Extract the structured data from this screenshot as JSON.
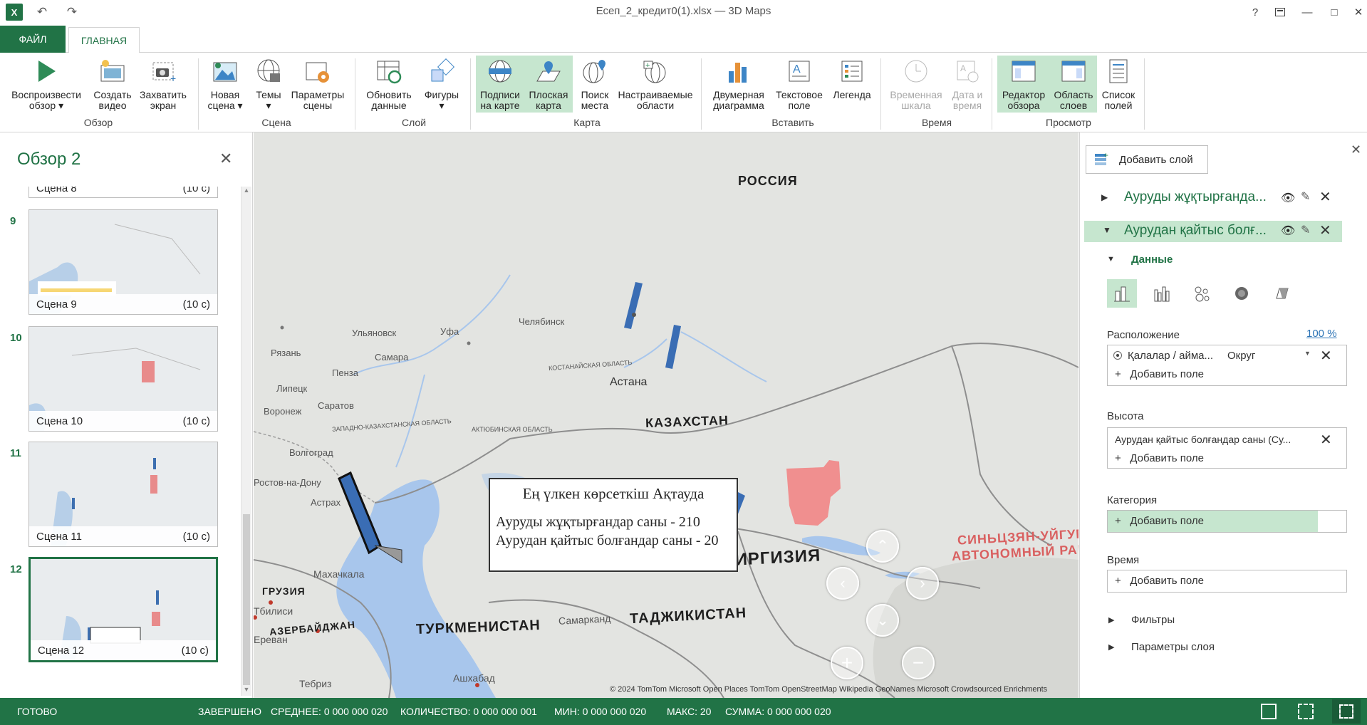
{
  "window": {
    "title": "Есеп_2_кредит0(1).xlsx — 3D Maps",
    "help": "?",
    "restore_icon": "restore-icon",
    "minimize": "—",
    "maximize": "□",
    "close": "✕"
  },
  "tabs": {
    "file": "ФАЙЛ",
    "home": "ГЛАВНАЯ"
  },
  "ribbon": {
    "play_tour": [
      "Воспроизвести",
      "обзор ▾"
    ],
    "create_video": [
      "Создать",
      "видео"
    ],
    "capture_screen": [
      "Захватить",
      "экран"
    ],
    "new_scene": [
      "Новая",
      "сцена ▾"
    ],
    "themes": [
      "Темы",
      "▾"
    ],
    "scene_options": [
      "Параметры",
      "сцены"
    ],
    "refresh_data": [
      "Обновить",
      "данные"
    ],
    "shapes": [
      "Фигуры",
      "▾"
    ],
    "map_labels": [
      "Подписи",
      "на карте"
    ],
    "flat_map": [
      "Плоская",
      "карта"
    ],
    "find_location": [
      "Поиск",
      "места"
    ],
    "custom_regions": [
      "Настраиваемые",
      "области"
    ],
    "chart_2d": [
      "Двумерная",
      "диаграмма"
    ],
    "text_box": [
      "Текстовое",
      "поле"
    ],
    "legend": [
      "Легенда",
      ""
    ],
    "timeline": [
      "Временная",
      "шкала"
    ],
    "date_time": [
      "Дата и",
      "время"
    ],
    "tour_editor": [
      "Редактор",
      "обзора"
    ],
    "layer_pane": [
      "Область",
      "слоев"
    ],
    "field_list": [
      "Список",
      "полей"
    ],
    "groups": {
      "tour": "Обзор",
      "scene": "Сцена",
      "layer": "Слой",
      "map": "Карта",
      "insert": "Вставить",
      "time": "Время",
      "view": "Просмотр"
    }
  },
  "tour_panel": {
    "title": "Обзор 2",
    "scenes": [
      {
        "num": "",
        "label": "Сцена 8",
        "duration": "(10 с)"
      },
      {
        "num": "9",
        "label": "Сцена 9",
        "duration": "(10 с)"
      },
      {
        "num": "10",
        "label": "Сцена 10",
        "duration": "(10 с)"
      },
      {
        "num": "11",
        "label": "Сцена 11",
        "duration": "(10 с)"
      },
      {
        "num": "12",
        "label": "Сцена 12",
        "duration": "(10 с)"
      }
    ]
  },
  "map": {
    "labels": {
      "russia": "РОССИЯ",
      "kazakhstan": "КАЗАХСТАН",
      "kyrgyzstan": "КИРГИЗИЯ",
      "tajikistan": "ТАДЖИКИСТАН",
      "turkmenistan": "ТУРКМЕНИСТАН",
      "georgia": "ГРУЗИЯ",
      "azerbaijan": "АЗЕРБАЙДЖАН",
      "xinjiang": [
        "СИНЬЦЗЯН-УЙГУР",
        "АВТОНОМНЫЙ РАЙ"
      ],
      "astana": "Астана",
      "ufa": "Уфа",
      "chelyabinsk": "Челябинск",
      "ulyanovsk": "Ульяновск",
      "samara": "Самара",
      "penza": "Пенза",
      "saratov": "Саратов",
      "ryazan": "Рязань",
      "lipetsk": "Липецк",
      "voronezh": "Воронеж",
      "volgograd": "Волгоград",
      "rostov": "Ростов-на-Дону",
      "astrakhan": "Астрах",
      "makhachkala": "Махачкала",
      "tbilisi": "Тбилиси",
      "yerevan": "Ереван",
      "tebriz": "Тебриз",
      "ashgabat": "Ашхабад",
      "samarkand": "Самарканд",
      "wk_region": "ЗАПАДНО-КАЗАХСТАНСКАЯ ОБЛАСТЬ",
      "aktobe_region": "АКТЮБИНСКАЯ ОБЛАСТЬ",
      "kostanay_region": "КОСТАНАЙСКАЯ ОБЛАСТЬ"
    },
    "attribution": "© 2024 TomTom  Microsoft  Open Places  TomTom  OpenStreetMap  Wikipedia  GeoNames  Microsoft Crowdsourced Enrichments",
    "tooltip": {
      "title": "Ең үлкен көрсеткіш Ақтауда",
      "line1": "Ауруды жұқтырғандар саны - 210",
      "line2": "Аурудан қайтыс болғандар саны - 20"
    }
  },
  "layer_panel": {
    "add_layer": "Добавить слой",
    "layer1": "Ауруды жұқтырғанда...",
    "layer2": "Аурудан қайтыс болғ...",
    "data_header": "Данные",
    "location_label": "Расположение",
    "location_pct": "100 %",
    "location_field": "Қалалар / айма...",
    "location_type": "Округ",
    "add_field": "Добавить поле",
    "height_label": "Высота",
    "height_field": "Аурудан қайтыс болғандар саны (Су...",
    "category_label": "Категория",
    "time_label": "Время",
    "filters": "Фильтры",
    "layer_options": "Параметры слоя",
    "accent": "#217346"
  },
  "status": {
    "ready": "ГОТОВО",
    "done": "ЗАВЕРШЕНО",
    "avg": "СРЕДНЕЕ: 0 000 000 020",
    "count": "КОЛИЧЕСТВО: 0 000 000 001",
    "min": "МИН: 0 000 000 020",
    "max": "МАКС: 20",
    "sum": "СУММА: 0 000 000 020"
  }
}
